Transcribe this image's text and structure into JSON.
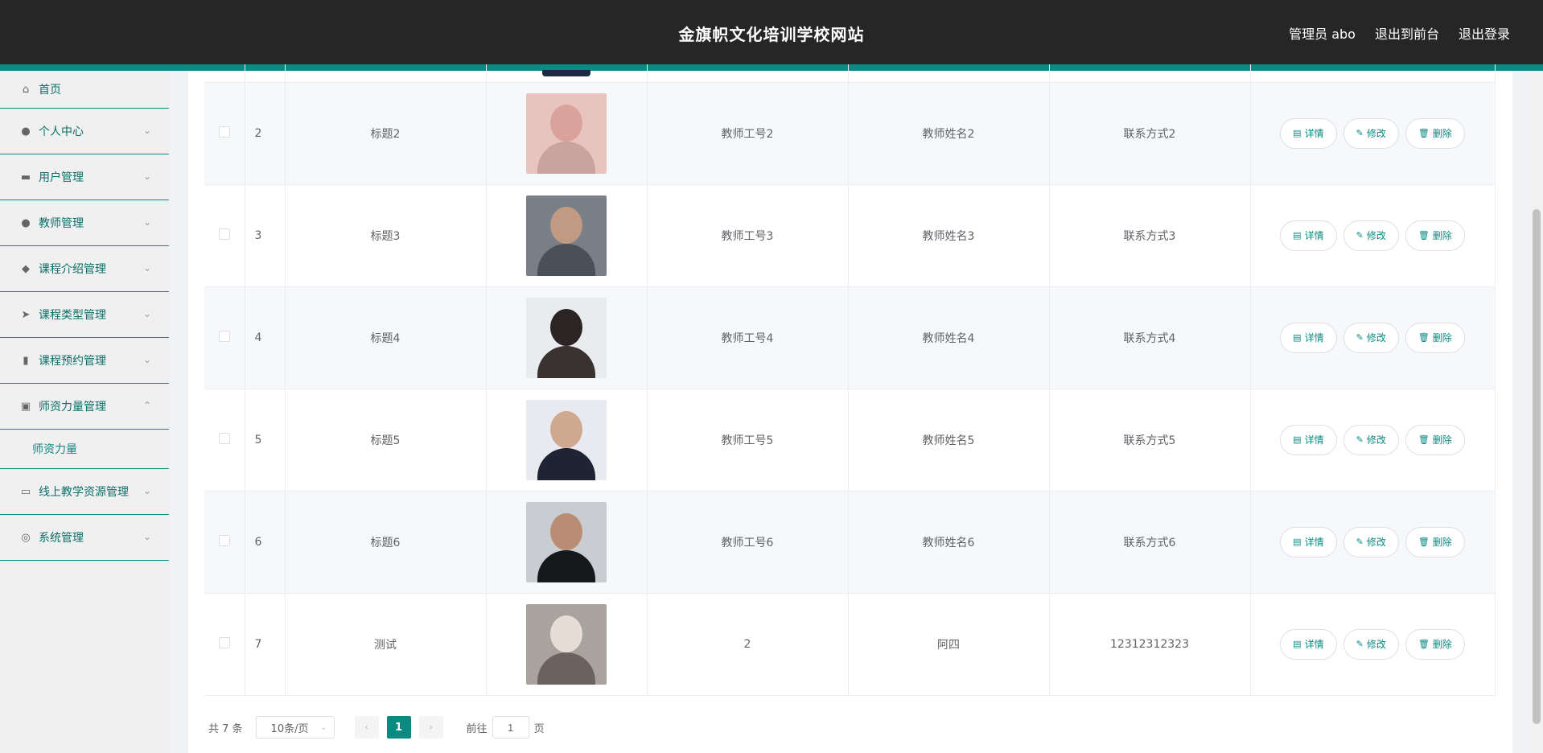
{
  "header": {
    "site_title": "金旗帜文化培训学校网站",
    "admin_label": "管理员 abo",
    "back_to_front": "退出到前台",
    "logout": "退出登录"
  },
  "sidebar": {
    "items": [
      {
        "label": "首页",
        "icon": "home-icon"
      },
      {
        "label": "个人中心",
        "icon": "user-icon"
      },
      {
        "label": "用户管理",
        "icon": "monitor-icon"
      },
      {
        "label": "教师管理",
        "icon": "person-icon"
      },
      {
        "label": "课程介绍管理",
        "icon": "location-icon"
      },
      {
        "label": "课程类型管理",
        "icon": "send-icon"
      },
      {
        "label": "课程预约管理",
        "icon": "bar-chart-icon"
      },
      {
        "label": "师资力量管理",
        "icon": "clipboard-icon"
      },
      {
        "label": "线上教学资源管理",
        "icon": "message-icon"
      },
      {
        "label": "系统管理",
        "icon": "settings-icon"
      }
    ],
    "sub_item": "师资力量"
  },
  "table": {
    "rows": [
      {
        "idx": "2",
        "title": "标题2",
        "teacher_no": "教师工号2",
        "teacher_name": "教师姓名2",
        "contact": "联系方式2",
        "photo_colors": [
          "#e8c4c0",
          "#d9a39b",
          "#caa39f"
        ]
      },
      {
        "idx": "3",
        "title": "标题3",
        "teacher_no": "教师工号3",
        "teacher_name": "教师姓名3",
        "contact": "联系方式3",
        "photo_colors": [
          "#7a7e86",
          "#c09a83",
          "#4b4f58"
        ]
      },
      {
        "idx": "4",
        "title": "标题4",
        "teacher_no": "教师工号4",
        "teacher_name": "教师姓名4",
        "contact": "联系方式4",
        "photo_colors": [
          "#e9ecef",
          "#2a2424",
          "#3a3131"
        ]
      },
      {
        "idx": "5",
        "title": "标题5",
        "teacher_no": "教师工号5",
        "teacher_name": "教师姓名5",
        "contact": "联系方式5",
        "photo_colors": [
          "#e8eaef",
          "#cfa98f",
          "#1e2433"
        ]
      },
      {
        "idx": "6",
        "title": "标题6",
        "teacher_no": "教师工号6",
        "teacher_name": "教师姓名6",
        "contact": "联系方式6",
        "photo_colors": [
          "#c9ccd1",
          "#b88d74",
          "#16181c"
        ]
      },
      {
        "idx": "7",
        "title": "测试",
        "teacher_no": "2",
        "teacher_name": "阿四",
        "contact": "12312312323",
        "photo_colors": [
          "#a9a39e",
          "#e8ddd6",
          "#6b625e"
        ]
      }
    ],
    "actions": {
      "detail": "详情",
      "edit": "修改",
      "delete": "删除"
    }
  },
  "pagination": {
    "total": "共 7 条",
    "page_size": "10条/页",
    "current_page": "1",
    "goto_label": "前往",
    "goto_value": "1",
    "page_suffix": "页"
  },
  "colors": {
    "accent": "#0b8a82",
    "topbar": "#262626"
  }
}
